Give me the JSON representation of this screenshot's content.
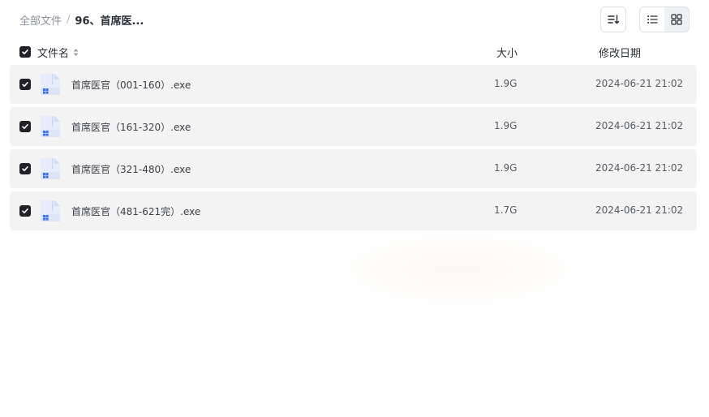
{
  "breadcrumb": {
    "root_label": "全部文件",
    "separator": "/",
    "current_label": "96、首席医..."
  },
  "toolbar": {
    "sort_icon": "sort-lines-icon",
    "view_list_icon": "list-view-icon",
    "view_grid_icon": "grid-view-icon",
    "active_view": "list"
  },
  "table": {
    "columns": {
      "name": "文件名",
      "size": "大小",
      "date": "修改日期"
    },
    "all_checked": true,
    "rows": [
      {
        "name": "首席医官（001-160）.exe",
        "size": "1.9G",
        "date": "2024-06-21 21:02",
        "checked": true
      },
      {
        "name": "首席医官（161-320）.exe",
        "size": "1.9G",
        "date": "2024-06-21 21:02",
        "checked": true
      },
      {
        "name": "首席医官（321-480）.exe",
        "size": "1.9G",
        "date": "2024-06-21 21:02",
        "checked": true
      },
      {
        "name": "首席医官（481-621完）.exe",
        "size": "1.7G",
        "date": "2024-06-21 21:02",
        "checked": true
      }
    ]
  },
  "colors": {
    "row_bg": "#f3f3f4",
    "checkbox": "#1f2329",
    "file_icon_accent": "#3a6ff0"
  }
}
